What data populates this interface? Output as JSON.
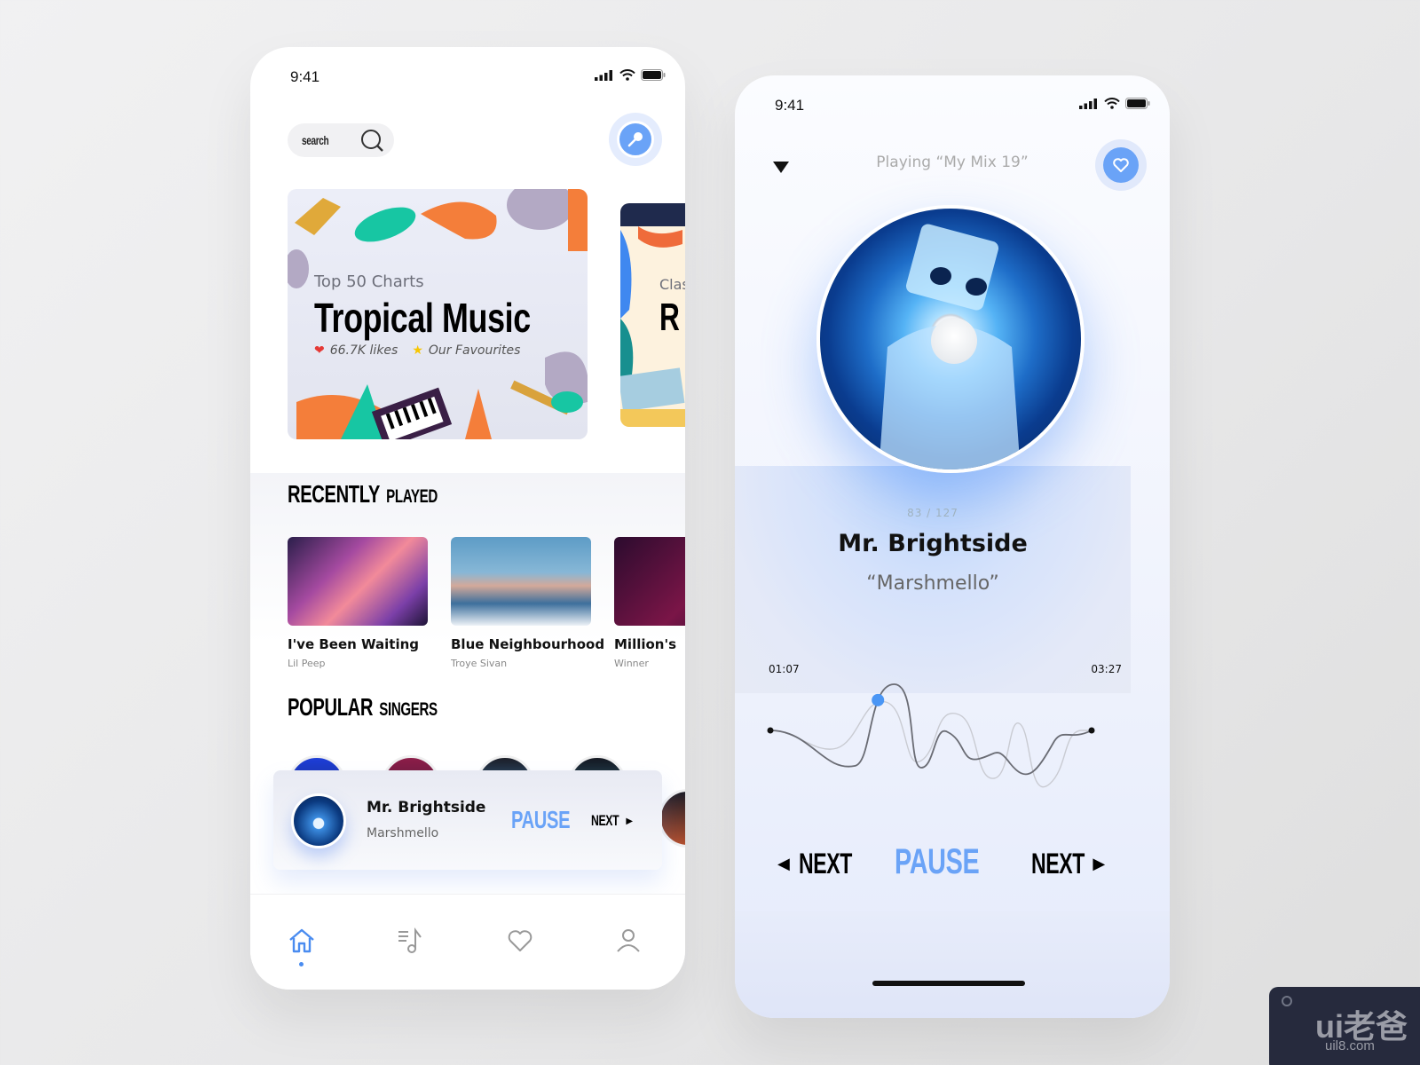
{
  "home": {
    "status": {
      "time": "9:41"
    },
    "search": {
      "placeholder": "search",
      "icon": "search-icon"
    },
    "mic_button": {
      "icon": "microphone-icon"
    },
    "featured": [
      {
        "subtitle": "Top 50 Charts",
        "title": "Tropical Music",
        "likes": "66.7K likes",
        "tag": "Our Favourites"
      },
      {
        "subtitle": "Clas",
        "title": "R"
      }
    ],
    "recently_played": {
      "title_big": "RECENTLY",
      "title_small": "PLAYED",
      "items": [
        {
          "title": "I've Been Waiting",
          "artist": "Lil Peep"
        },
        {
          "title": "Blue Neighbourhood",
          "artist": "Troye Sivan"
        },
        {
          "title": "Million's",
          "artist": "Winner"
        }
      ]
    },
    "popular_singers": {
      "title_big": "POPULAR",
      "title_small": "SINGERS"
    },
    "mini_player": {
      "title": "Mr. Brightside",
      "artist": "Marshmello",
      "pause": "PAUSE",
      "next": "NEXT"
    },
    "tabs": [
      {
        "name": "home",
        "icon": "home-icon",
        "active": true
      },
      {
        "name": "playlist",
        "icon": "playlist-icon"
      },
      {
        "name": "favorites",
        "icon": "heart-icon"
      },
      {
        "name": "profile",
        "icon": "user-icon"
      }
    ],
    "accent": "#6aa3f7"
  },
  "player": {
    "status": {
      "time": "9:41"
    },
    "playing_label": "Playing “My Mix 19”",
    "counter": "83 / 127",
    "song": "Mr. Brightside",
    "artist": "“Marshmello”",
    "current_time": "01:07",
    "total_time": "03:27",
    "progress": 0.32,
    "controls": {
      "prev": "NEXT",
      "pause": "PAUSE",
      "next": "NEXT"
    }
  },
  "watermark": {
    "logo": "ui老爸",
    "url": "uil8.com"
  }
}
